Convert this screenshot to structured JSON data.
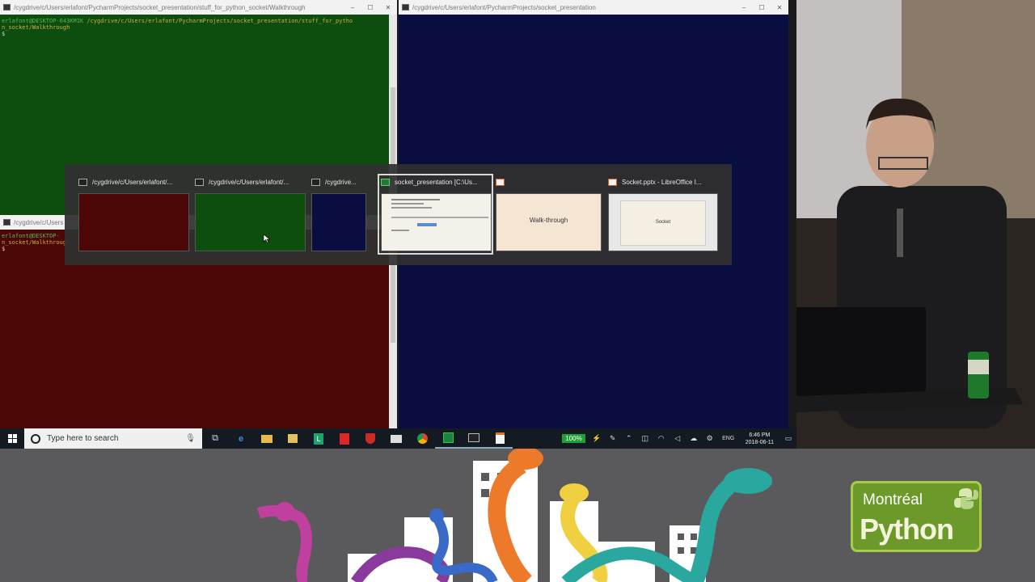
{
  "windows": {
    "green": {
      "title": "/cygdrive/c/Users/erlafont/PycharmProjects/socket_presentation/stuff_for_python_socket/Walkthrough",
      "prompt_user": "erlafont@DESKTOP-643KM1K",
      "prompt_path": "/cygdrive/c/Users/erlafont/PycharmProjects/socket_presentation/stuff_for_pytho",
      "prompt_path_cont": "n_socket/Walkthrough",
      "cursor": "$"
    },
    "red": {
      "title": "/cygdrive/c/Users",
      "prompt_user": "erlafont@DESKTOP-",
      "prompt_path_cont": "n_socket/Walkthrough",
      "cursor": "$"
    },
    "blue": {
      "title": "/cygdrive/c/Users/erlafont/PycharmProjects/socket_presentation"
    },
    "controls": {
      "minimize": "–",
      "maximize": "☐",
      "close": "✕"
    }
  },
  "switcher": {
    "items": [
      {
        "label": "/cygdrive/c/Users/erlafont/...",
        "icon": "terminal-icon",
        "color": "#4b0606"
      },
      {
        "label": "/cygdrive/c/Users/erlafont/...",
        "icon": "terminal-icon",
        "color": "#0d4d0d"
      },
      {
        "label": "/cygdrive...",
        "icon": "terminal-icon",
        "color": "#090d3f"
      },
      {
        "label": "socket_presentation [C:\\Us...",
        "icon": "pycharm-icon",
        "color": "#f4f1ea",
        "selected": true
      },
      {
        "label": "",
        "icon": "impress-doc-icon",
        "color": "#f5e6d3",
        "thumb_text": "Walk-through"
      },
      {
        "label": "Socket.pptx - LibreOffice I...",
        "icon": "impress-doc-icon",
        "color": "#e8e8e8",
        "thumb_text": "Socket"
      }
    ]
  },
  "taskbar": {
    "search_placeholder": "Type here to search",
    "battery": "100%",
    "language": "ENG",
    "time": "6:46 PM",
    "date": "2018-06-11"
  },
  "banner": {
    "logo_top": "Montréal",
    "logo_bottom": "Python"
  }
}
